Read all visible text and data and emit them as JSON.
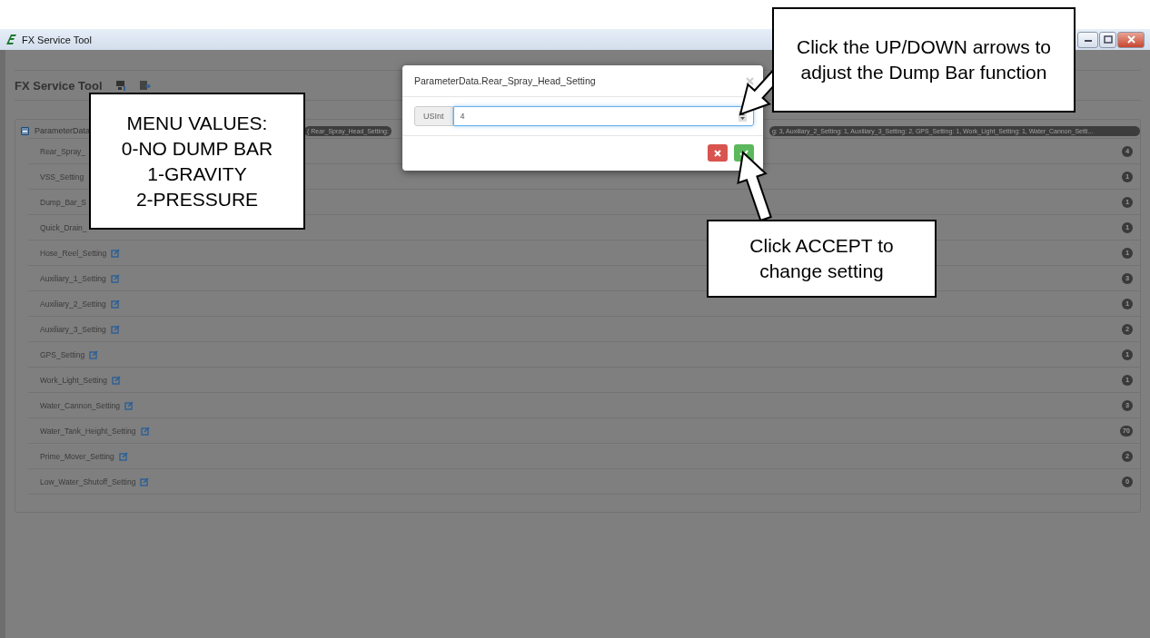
{
  "window": {
    "title": "FX Service Tool"
  },
  "header": {
    "title": "FX Service Tool"
  },
  "tree": {
    "label": "ParameterData",
    "expanded": true,
    "summary_left": "{ Rear_Spray_Head_Setting:",
    "summary_right": "g: 3, Auxiliary_2_Setting: 1, Auxiliary_3_Setting: 2, GPS_Setting: 1, Work_Light_Setting: 1, Water_Cannon_Setti...",
    "items": [
      {
        "label": "Rear_Spray_",
        "value": "4",
        "editable": false
      },
      {
        "label": "VSS_Setting",
        "value": "1",
        "editable": false
      },
      {
        "label": "Dump_Bar_S",
        "value": "1",
        "editable": false
      },
      {
        "label": "Quick_Drain_",
        "value": "1",
        "editable": false
      },
      {
        "label": "Hose_Reel_Setting",
        "value": "1",
        "editable": true
      },
      {
        "label": "Auxiliary_1_Setting",
        "value": "3",
        "editable": true
      },
      {
        "label": "Auxiliary_2_Setting",
        "value": "1",
        "editable": true
      },
      {
        "label": "Auxiliary_3_Setting",
        "value": "2",
        "editable": true
      },
      {
        "label": "GPS_Setting",
        "value": "1",
        "editable": true
      },
      {
        "label": "Work_Light_Setting",
        "value": "1",
        "editable": true
      },
      {
        "label": "Water_Cannon_Setting",
        "value": "3",
        "editable": true
      },
      {
        "label": "Water_Tank_Height_Setting",
        "value": "70",
        "editable": true
      },
      {
        "label": "Prime_Mover_Setting",
        "value": "2",
        "editable": true
      },
      {
        "label": "Low_Water_Shutoff_Setting",
        "value": "0",
        "editable": true
      }
    ]
  },
  "dialog": {
    "title": "ParameterData.Rear_Spray_Head_Setting",
    "addon": "USInt",
    "value": "4"
  },
  "callouts": [
    {
      "lines": [
        "MENU VALUES:",
        "0-NO DUMP BAR",
        "1-GRAVITY",
        "2-PRESSURE"
      ]
    },
    {
      "lines": [
        "Click the UP/DOWN arrows to adjust the Dump Bar function"
      ]
    },
    {
      "lines": [
        "Click ACCEPT to change setting"
      ]
    }
  ]
}
